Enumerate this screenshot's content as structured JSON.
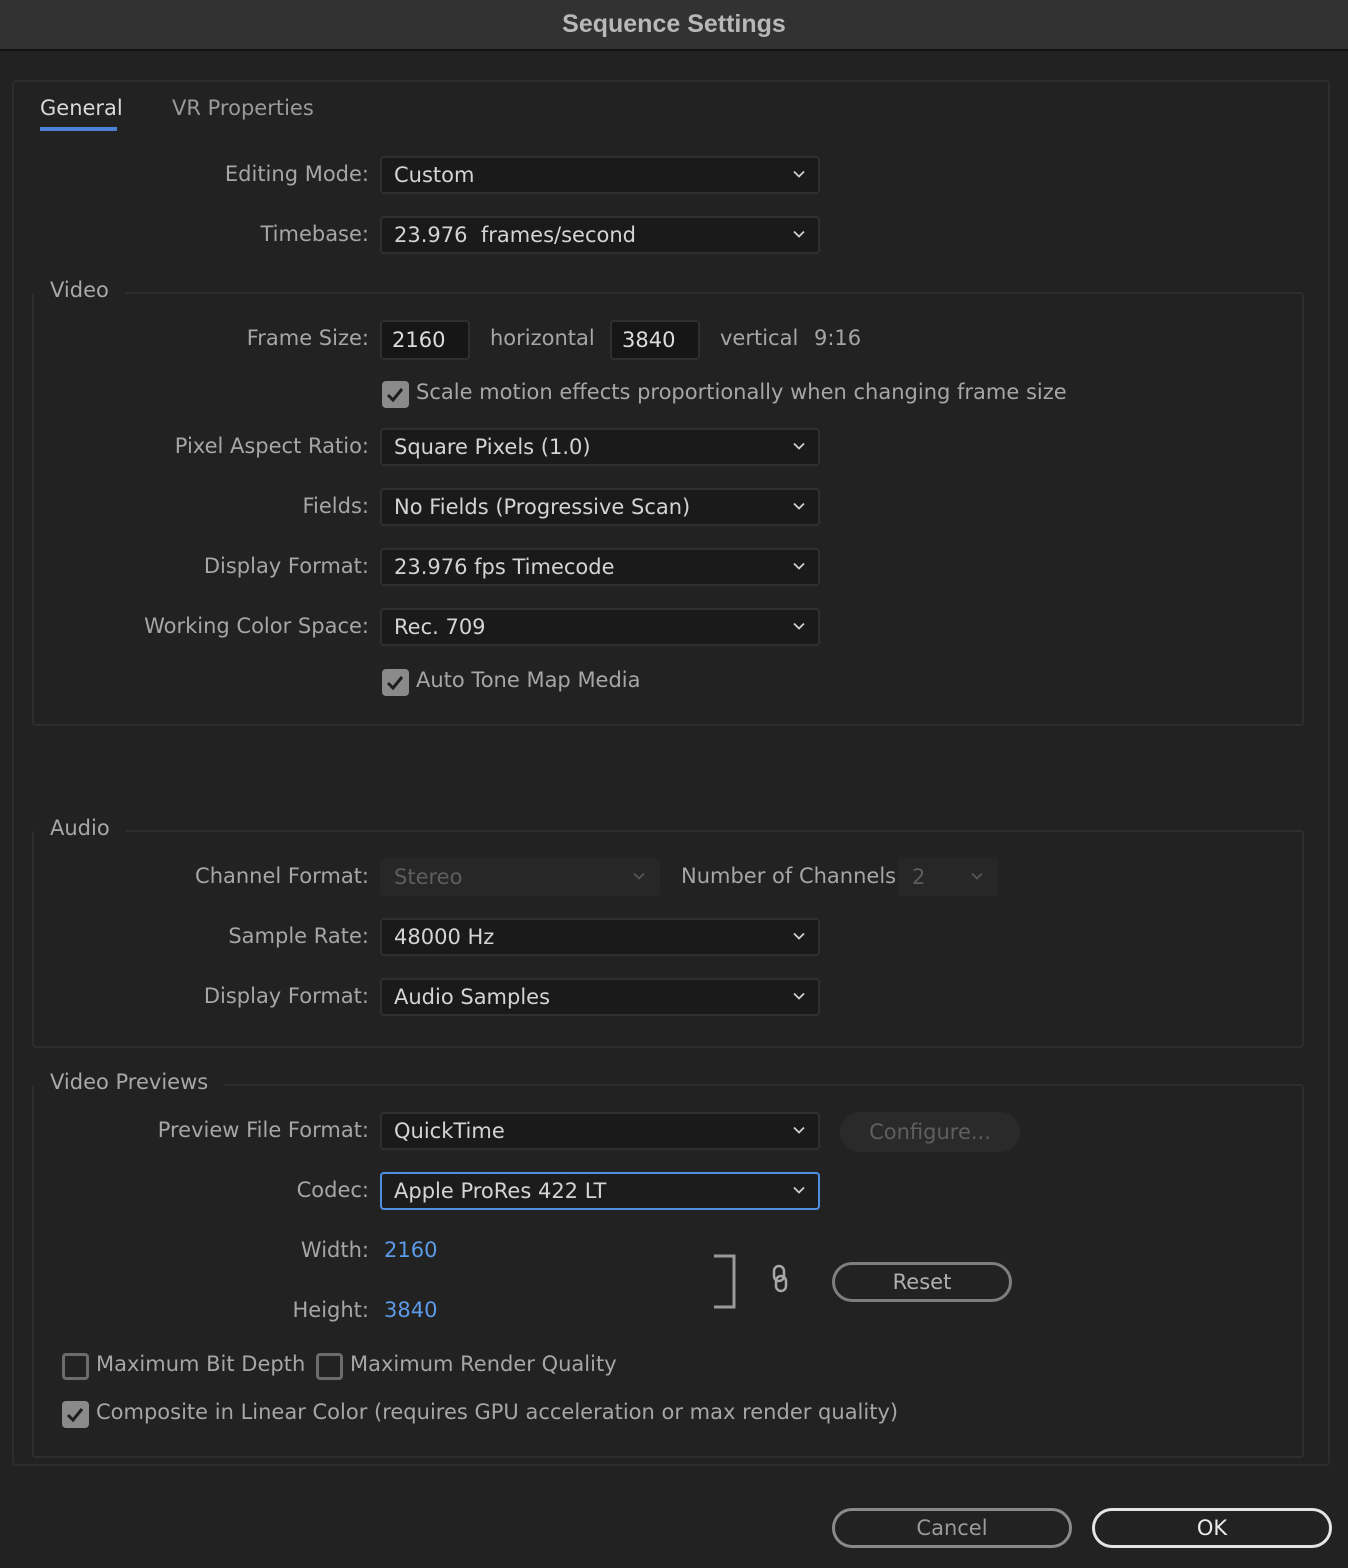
{
  "window": {
    "title": "Sequence Settings"
  },
  "tabs": [
    {
      "label": "General",
      "active": true
    },
    {
      "label": "VR Properties",
      "active": false
    }
  ],
  "general": {
    "editing_mode": {
      "label": "Editing Mode:",
      "value": "Custom"
    },
    "timebase": {
      "label": "Timebase:",
      "value": "23.976  frames/second"
    }
  },
  "video": {
    "title": "Video",
    "frame_size": {
      "label": "Frame Size:",
      "horizontal": "2160",
      "horizontal_label": "horizontal",
      "vertical": "3840",
      "vertical_label": "vertical",
      "ratio": "9:16"
    },
    "scale_motion": {
      "label": "Scale motion effects proportionally when changing frame size",
      "checked": true
    },
    "pixel_aspect_ratio": {
      "label": "Pixel Aspect Ratio:",
      "value": "Square Pixels (1.0)"
    },
    "fields": {
      "label": "Fields:",
      "value": "No Fields (Progressive Scan)"
    },
    "display_format": {
      "label": "Display Format:",
      "value": "23.976 fps Timecode"
    },
    "working_color_space": {
      "label": "Working Color Space:",
      "value": "Rec. 709"
    },
    "auto_tone_map": {
      "label": "Auto Tone Map Media",
      "checked": true
    }
  },
  "audio": {
    "title": "Audio",
    "channel_format": {
      "label": "Channel Format:",
      "value": "Stereo",
      "disabled": true
    },
    "number_of_channels": {
      "label": "Number of Channels:",
      "value": "2",
      "disabled": true
    },
    "sample_rate": {
      "label": "Sample Rate:",
      "value": "48000 Hz"
    },
    "display_format": {
      "label": "Display Format:",
      "value": "Audio Samples"
    }
  },
  "video_previews": {
    "title": "Video Previews",
    "preview_file_format": {
      "label": "Preview File Format:",
      "value": "QuickTime"
    },
    "configure_label": "Configure...",
    "codec": {
      "label": "Codec:",
      "value": "Apple ProRes 422 LT"
    },
    "width": {
      "label": "Width:",
      "value": "2160"
    },
    "height": {
      "label": "Height:",
      "value": "3840"
    },
    "reset_label": "Reset",
    "max_bit_depth": {
      "label": "Maximum Bit Depth",
      "checked": false
    },
    "max_render_quality": {
      "label": "Maximum Render Quality",
      "checked": false
    },
    "composite_linear": {
      "label": "Composite in Linear Color (requires GPU acceleration or max render quality)",
      "checked": true
    }
  },
  "footer": {
    "cancel_label": "Cancel",
    "ok_label": "OK"
  },
  "colors": {
    "accent": "#4a82d6",
    "link_value": "#5b9ae6",
    "background": "#222222",
    "titlebar": "#323232"
  }
}
